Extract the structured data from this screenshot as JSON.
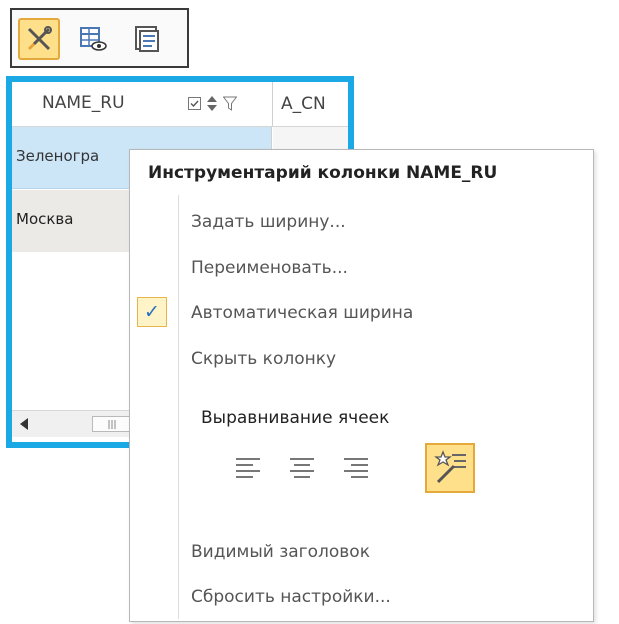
{
  "toolbar": {
    "buttons": [
      {
        "icon": "column-tools-icon",
        "active": true
      },
      {
        "icon": "table-view-icon",
        "active": false
      },
      {
        "icon": "form-view-icon",
        "active": false
      }
    ]
  },
  "grid": {
    "columns": [
      {
        "label": "NAME_RU"
      },
      {
        "label": "A_CN"
      }
    ],
    "header_icons": [
      "checkbox-icon",
      "sort-icon",
      "filter-icon"
    ],
    "rows": [
      {
        "name_ru": "Зеленогра"
      },
      {
        "name_ru": "Москва"
      }
    ],
    "accent_color": "#1aa9e5"
  },
  "menu": {
    "title": "Инструментарий колонки NAME_RU",
    "items": [
      {
        "label": "Задать ширину..."
      },
      {
        "label": "Переименовать..."
      },
      {
        "label": "Автоматическая ширина",
        "checked": true
      },
      {
        "label": "Скрыть колонку"
      }
    ],
    "alignment": {
      "title": "Выравнивание ячеек",
      "options": [
        {
          "icon": "align-left-icon",
          "active": false
        },
        {
          "icon": "align-center-icon",
          "active": false
        },
        {
          "icon": "align-right-icon",
          "active": false
        },
        {
          "icon": "align-auto-icon",
          "active": true
        }
      ]
    },
    "footer_items": [
      {
        "label": "Видимый заголовок"
      },
      {
        "label": "Сбросить настройки..."
      }
    ]
  }
}
